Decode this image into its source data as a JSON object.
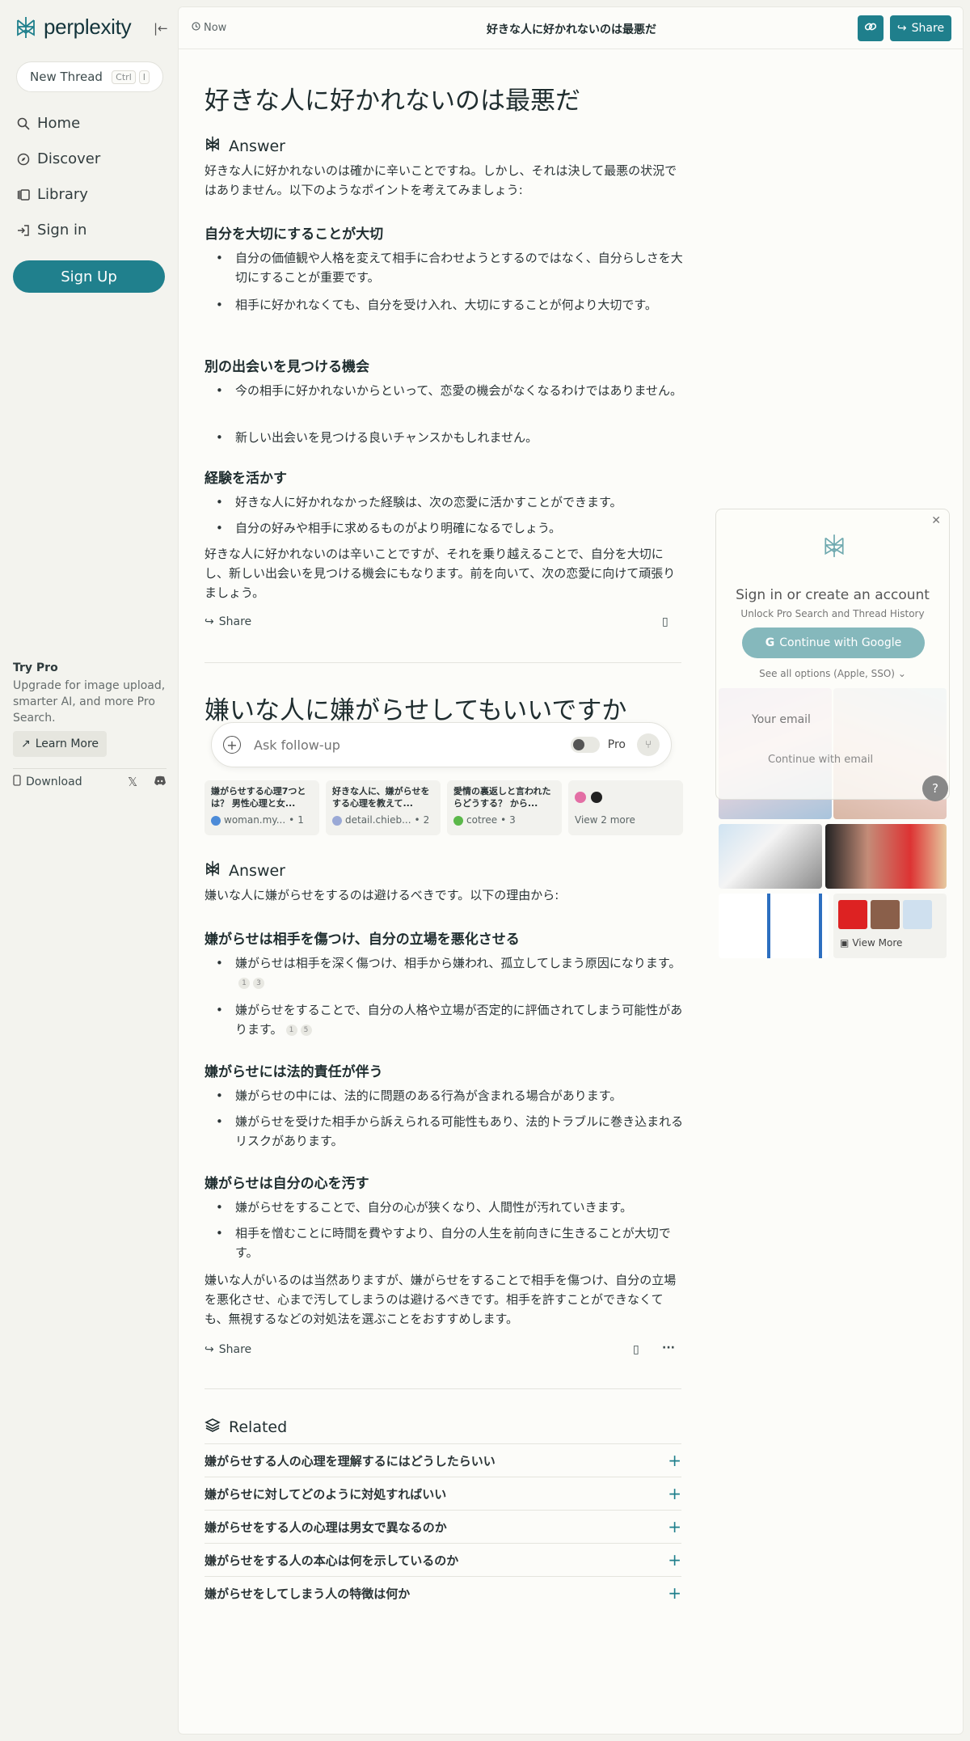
{
  "app": {
    "name": "perplexity"
  },
  "sidebar": {
    "new_thread": "New Thread",
    "shortcut": [
      "Ctrl",
      "I"
    ],
    "nav": [
      {
        "label": "Home",
        "icon": "search-icon"
      },
      {
        "label": "Discover",
        "icon": "compass-icon"
      },
      {
        "label": "Library",
        "icon": "library-icon"
      },
      {
        "label": "Sign in",
        "icon": "sign-in-icon"
      }
    ],
    "signup": "Sign Up",
    "try_pro_title": "Try Pro",
    "try_pro_desc": "Upgrade for image upload, smarter AI, and more Pro Search.",
    "learn_more": "Learn More",
    "download": "Download"
  },
  "topbar": {
    "time": "Now",
    "title": "好きな人に好かれないのは最悪だ",
    "share": "Share"
  },
  "thread1": {
    "question": "好きな人に好かれないのは最悪だ",
    "answer_label": "Answer",
    "intro": "好きな人に好かれないのは確かに辛いことですね。しかし、それは決して最悪の状況ではありません。以下のようなポイントを考えてみましょう:",
    "sections": [
      {
        "heading": "自分を大切にすることが大切",
        "items": [
          "自分の価値観や人格を変えて相手に合わせようとするのではなく、自分らしさを大切にすることが重要です。",
          "相手に好かれなくても、自分を受け入れ、大切にすることが何より大切です。"
        ]
      },
      {
        "heading": "別の出会いを見つける機会",
        "items": [
          "今の相手に好かれないからといって、恋愛の機会がなくなるわけではありません。",
          "新しい出会いを見つける良いチャンスかもしれません。"
        ]
      },
      {
        "heading": "経験を活かす",
        "items": [
          "好きな人に好かれなかった経験は、次の恋愛に活かすことができます。",
          "自分の好みや相手に求めるものがより明確になるでしょう。"
        ]
      }
    ],
    "conclusion": "好きな人に好かれないのは辛いことですが、それを乗り越えることで、自分を大切にし、新しい出会いを見つける機会にもなります。前を向いて、次の恋愛に向けて頑張りましょう。",
    "share": "Share"
  },
  "thread2": {
    "question": "嫌いな人に嫌がらせしてもいいですか",
    "sources": [
      {
        "title": "嫌がらせする心理7つとは？ 男性心理と女...",
        "site": "woman.my...",
        "num": "1"
      },
      {
        "title": "好きな人に、嫌がらせをする心理を教えて...",
        "site": "detail.chieb...",
        "num": "2"
      },
      {
        "title": "愛情の裏返しと言われたらどうする？ から...",
        "site": "cotree",
        "num": "3"
      }
    ],
    "view_more": "View 2 more",
    "answer_label": "Answer",
    "intro": "嫌いな人に嫌がらせをするのは避けるべきです。以下の理由から:",
    "sections": [
      {
        "heading": "嫌がらせは相手を傷つけ、自分の立場を悪化させる",
        "items": [
          "嫌がらせは相手を深く傷つけ、相手から嫌われ、孤立してしまう原因になります。",
          "嫌がらせをすることで、自分の人格や立場が否定的に評価されてしまう可能性があります。"
        ]
      },
      {
        "heading": "嫌がらせには法的責任が伴う",
        "items": [
          "嫌がらせの中には、法的に問題のある行為が含まれる場合があります。",
          "嫌がらせを受けた相手から訴えられる可能性もあり、法的トラブルに巻き込まれるリスクがあります。"
        ]
      },
      {
        "heading": "嫌がらせは自分の心を汚す",
        "items": [
          "嫌がらせをすることで、自分の心が狭くなり、人間性が汚れていきます。",
          "相手を憎むことに時間を費やすより、自分の人生を前向きに生きることが大切です。"
        ]
      }
    ],
    "citations": [
      [
        "1",
        "3"
      ],
      [
        "1",
        "5"
      ]
    ],
    "conclusion": "嫌いな人がいるのは当然ありますが、嫌がらせをすることで相手を傷つけ、自分の立場を悪化させ、心まで汚してしまうのは避けるべきです。相手を許すことができなくても、無視するなどの対処法を選ぶことをおすすめします。",
    "share": "Share"
  },
  "ask": {
    "placeholder": "Ask follow-up",
    "pro": "Pro"
  },
  "related": {
    "label": "Related",
    "items": [
      "嫌がらせする人の心理を理解するにはどうしたらいい",
      "嫌がらせに対してどのように対処すればいい",
      "嫌がらせをする人の心理は男女で異なるのか",
      "嫌がらせをする人の本心は何を示しているのか",
      "嫌がらせをしてしまう人の特徴は何か"
    ]
  },
  "images": {
    "view_more": "View More"
  },
  "login": {
    "title": "Sign in or create an account",
    "subtitle": "Unlock Pro Search and Thread History",
    "google": "Continue with Google",
    "more": "See all options (Apple, SSO)",
    "email": "Your email",
    "continue": "Continue with email"
  },
  "help": "?",
  "colors": {
    "accent": "#20808d",
    "background": "#fcfcf9",
    "sidebar": "#f3f3ee"
  }
}
